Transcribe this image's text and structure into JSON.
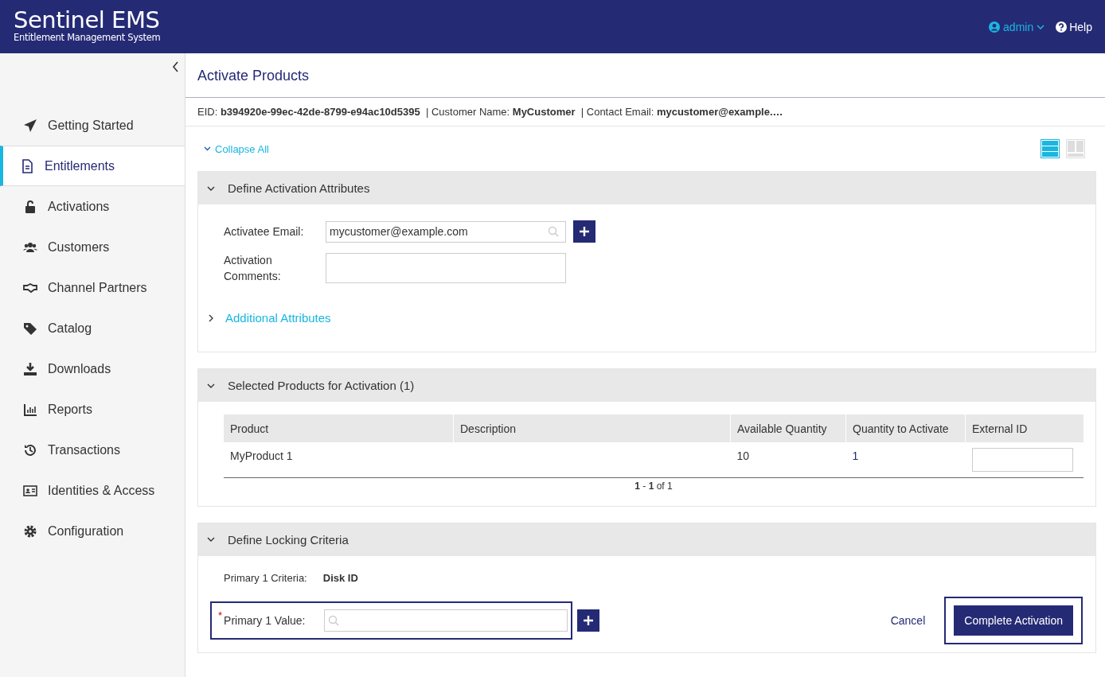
{
  "header": {
    "logo_title": "Sentinel EMS",
    "logo_subtitle": "Entitlement Management System",
    "user": "admin",
    "help": "Help"
  },
  "sidebar": {
    "items": [
      {
        "label": "Getting Started",
        "selected": false
      },
      {
        "label": "Entitlements",
        "selected": true
      },
      {
        "label": "Activations",
        "selected": false
      },
      {
        "label": "Customers",
        "selected": false
      },
      {
        "label": "Channel Partners",
        "selected": false
      },
      {
        "label": "Catalog",
        "selected": false
      },
      {
        "label": "Downloads",
        "selected": false
      },
      {
        "label": "Reports",
        "selected": false
      },
      {
        "label": "Transactions",
        "selected": false
      },
      {
        "label": "Identities & Access",
        "selected": false
      },
      {
        "label": "Configuration",
        "selected": false
      }
    ]
  },
  "page": {
    "title": "Activate Products",
    "info": "EID: **b394920e-99ec-42de-8799-e94ac10d5395**  | Customer Name: **MyCustomer**  | Contact Email: **mycustomer@example.…**",
    "collapse_all": "Collapse All",
    "view_options": [
      {
        "selected": true
      },
      {
        "selected": false
      }
    ]
  },
  "attributes": {
    "title": "Define Activation Attributes",
    "expanded": true,
    "email_label": "Activatee Email:",
    "email_value": "mycustomer@example.com",
    "comments_label": "Activation Comments:",
    "additional": "Additional Attributes",
    "additional_expanded": false
  },
  "products": {
    "title": "Selected Products for Activation (1)",
    "expanded": true,
    "columns": [
      "Product",
      "Description",
      "Available Quantity",
      "Quantity to Activate",
      "External ID"
    ],
    "rows": [
      {
        "product": "MyProduct 1",
        "description": "",
        "available": "10",
        "quantity": "1"
      }
    ],
    "pagination": "**1** - **1** of 1"
  },
  "locking": {
    "title": "Define Locking Criteria",
    "expanded": true,
    "criteria_label": "Primary 1 Criteria:",
    "criteria_value": "Disk ID",
    "required_mark": "*",
    "value_label": "Primary 1 Value:"
  },
  "actions": {
    "cancel": "Cancel",
    "complete": "Complete Activation"
  }
}
